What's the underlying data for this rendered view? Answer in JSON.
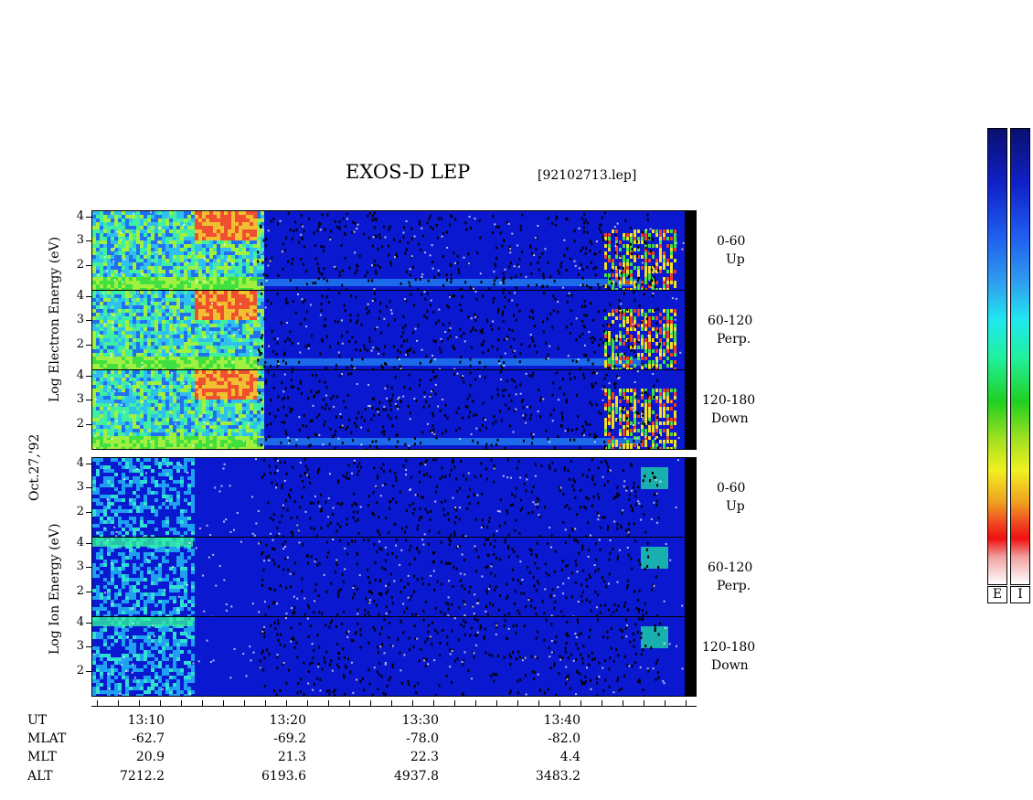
{
  "title": "EXOS-D LEP",
  "file": "[92102713.lep]",
  "date_label": "Oct.27,'92",
  "electron_axis_label": "Log Electron Energy (eV)",
  "ion_axis_label": "Log Ion Energy (eV)",
  "colorbar": {
    "labels": [
      "E",
      "I"
    ]
  },
  "panels": [
    {
      "group": "electron",
      "angle": "0-60",
      "dir": "Up"
    },
    {
      "group": "electron",
      "angle": "60-120",
      "dir": "Perp."
    },
    {
      "group": "electron",
      "angle": "120-180",
      "dir": "Down"
    },
    {
      "group": "ion",
      "angle": "0-60",
      "dir": "Up"
    },
    {
      "group": "ion",
      "angle": "60-120",
      "dir": "Perp."
    },
    {
      "group": "ion",
      "angle": "120-180",
      "dir": "Down"
    }
  ],
  "chart_data": {
    "type": "heatmap",
    "title": "EXOS-D LEP",
    "y_ticks": [
      "4",
      "3",
      "2"
    ],
    "x_ticks": [
      "13:10",
      "13:20",
      "13:30",
      "13:40"
    ],
    "rows": [
      {
        "label": "UT",
        "values": [
          "13:10",
          "13:20",
          "13:30",
          "13:40"
        ]
      },
      {
        "label": "MLAT",
        "values": [
          "-62.7",
          "-69.2",
          "-78.0",
          "-82.0"
        ]
      },
      {
        "label": "MLT",
        "values": [
          "20.9",
          "21.3",
          "22.3",
          "4.4"
        ]
      },
      {
        "label": "ALT",
        "values": [
          "7212.2",
          "6193.6",
          "4937.8",
          "3483.2"
        ]
      }
    ]
  }
}
